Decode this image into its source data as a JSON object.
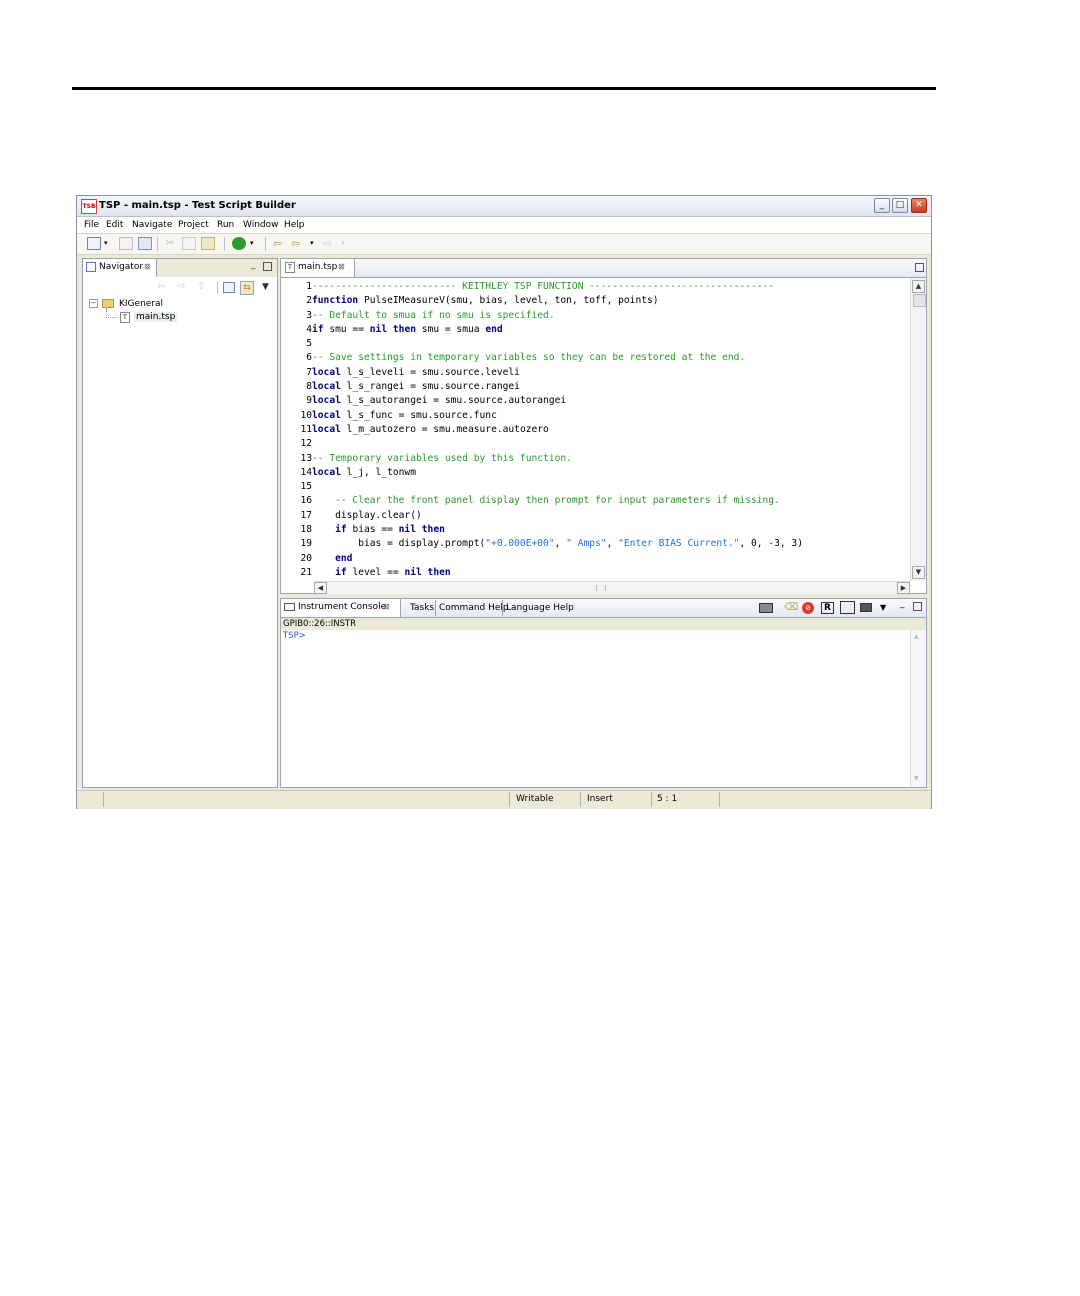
{
  "window": {
    "title": "TSP - main.tsp - Test Script Builder",
    "app_icon_text": "TSB",
    "minimize_glyph": "_",
    "maximize_glyph": "□",
    "close_glyph": "✕"
  },
  "menu": [
    "File",
    "Edit",
    "Navigate",
    "Project",
    "Run",
    "Window",
    "Help"
  ],
  "navigator": {
    "tab_label": "Navigator",
    "close_glyph": "⊠",
    "tree": [
      {
        "label": "KIGeneral",
        "icon": "folder-icon"
      },
      {
        "label": "main.tsp",
        "icon": "tsp-file-icon"
      }
    ]
  },
  "editor": {
    "tab_label": "main.tsp",
    "close_glyph": "⊠",
    "lines": [
      {
        "n": "1",
        "parts": [
          {
            "t": "------------------------- KEITHLEY TSP FUNCTION --------------------------------",
            "c": "cm"
          }
        ]
      },
      {
        "n": "2",
        "parts": [
          {
            "t": "function",
            "c": "kw"
          },
          {
            "t": " PulseIMeasureV(smu, bias, level, ton, toff, points)",
            "c": ""
          }
        ]
      },
      {
        "n": "3",
        "parts": [
          {
            "t": "-- Default to smua if no smu is specified.",
            "c": "cm"
          }
        ]
      },
      {
        "n": "4",
        "parts": [
          {
            "t": "if",
            "c": "kw"
          },
          {
            "t": " smu == ",
            "c": ""
          },
          {
            "t": "nil",
            "c": "kw"
          },
          {
            "t": " ",
            "c": ""
          },
          {
            "t": "then",
            "c": "kw"
          },
          {
            "t": " smu = smua ",
            "c": ""
          },
          {
            "t": "end",
            "c": "kw"
          }
        ]
      },
      {
        "n": "5",
        "parts": [
          {
            "t": "",
            "c": ""
          }
        ]
      },
      {
        "n": "6",
        "parts": [
          {
            "t": "-- Save settings in temporary variables so they can be restored at the end.",
            "c": "cm"
          }
        ]
      },
      {
        "n": "7",
        "parts": [
          {
            "t": "local",
            "c": "kw"
          },
          {
            "t": " l_s_leveli = smu.source.leveli",
            "c": ""
          }
        ]
      },
      {
        "n": "8",
        "parts": [
          {
            "t": "local",
            "c": "kw"
          },
          {
            "t": " l_s_rangei = smu.source.rangei",
            "c": ""
          }
        ]
      },
      {
        "n": "9",
        "parts": [
          {
            "t": "local",
            "c": "kw"
          },
          {
            "t": " l_s_autorangei = smu.source.autorangei",
            "c": ""
          }
        ]
      },
      {
        "n": "10",
        "parts": [
          {
            "t": "local",
            "c": "kw"
          },
          {
            "t": " l_s_func = smu.source.func",
            "c": ""
          }
        ]
      },
      {
        "n": "11",
        "parts": [
          {
            "t": "local",
            "c": "kw"
          },
          {
            "t": " l_m_autozero = smu.measure.autozero",
            "c": ""
          }
        ]
      },
      {
        "n": "12",
        "parts": [
          {
            "t": "",
            "c": ""
          }
        ]
      },
      {
        "n": "13",
        "parts": [
          {
            "t": "-- Temporary variables used by this function.",
            "c": "cm"
          }
        ]
      },
      {
        "n": "14",
        "parts": [
          {
            "t": "local",
            "c": "kw"
          },
          {
            "t": " l_j, l_tonwm",
            "c": ""
          }
        ]
      },
      {
        "n": "15",
        "parts": [
          {
            "t": "",
            "c": ""
          }
        ]
      },
      {
        "n": "16",
        "parts": [
          {
            "t": "    ",
            "c": ""
          },
          {
            "t": "-- Clear the front panel display then prompt for input parameters if missing.",
            "c": "cm"
          }
        ]
      },
      {
        "n": "17",
        "parts": [
          {
            "t": "    display.clear()",
            "c": ""
          }
        ]
      },
      {
        "n": "18",
        "parts": [
          {
            "t": "    ",
            "c": ""
          },
          {
            "t": "if",
            "c": "kw"
          },
          {
            "t": " bias == ",
            "c": ""
          },
          {
            "t": "nil",
            "c": "kw"
          },
          {
            "t": " ",
            "c": ""
          },
          {
            "t": "then",
            "c": "kw"
          }
        ]
      },
      {
        "n": "19",
        "parts": [
          {
            "t": "        bias = display.prompt(",
            "c": ""
          },
          {
            "t": "\"+0.000E+00\"",
            "c": "st"
          },
          {
            "t": ", ",
            "c": ""
          },
          {
            "t": "\" Amps\"",
            "c": "st"
          },
          {
            "t": ", ",
            "c": ""
          },
          {
            "t": "\"Enter BIAS Current.\"",
            "c": "st"
          },
          {
            "t": ", 0, -3, 3)",
            "c": ""
          }
        ]
      },
      {
        "n": "20",
        "parts": [
          {
            "t": "    ",
            "c": ""
          },
          {
            "t": "end",
            "c": "kw"
          }
        ]
      },
      {
        "n": "21",
        "parts": [
          {
            "t": "    ",
            "c": ""
          },
          {
            "t": "if",
            "c": "kw"
          },
          {
            "t": " level == ",
            "c": ""
          },
          {
            "t": "nil",
            "c": "kw"
          },
          {
            "t": " ",
            "c": ""
          },
          {
            "t": "then",
            "c": "kw"
          }
        ]
      }
    ]
  },
  "console": {
    "tabs": [
      "Instrument Console",
      "Tasks",
      "Command Help",
      "Language Help"
    ],
    "close_glyph": "⊠",
    "connection": "GPIB0::26::INSTR",
    "prompt": "TSP>"
  },
  "status": {
    "writable": "Writable",
    "insert": "Insert",
    "position": "5 : 1"
  },
  "colors": {
    "keyword": "#000080",
    "comment": "#2a9a2a",
    "string": "#2a6ed8",
    "prompt": "#1f5fbf"
  }
}
